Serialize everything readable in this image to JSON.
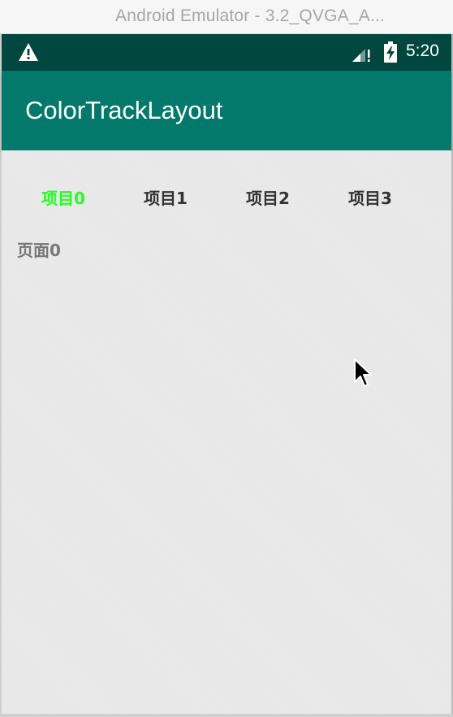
{
  "window": {
    "title": "Android Emulator - 3.2_QVGA_A..."
  },
  "status_bar": {
    "time": "5:20",
    "icons": [
      "warning-icon",
      "signal-icon",
      "battery-charging-icon"
    ]
  },
  "app_bar": {
    "title": "ColorTrackLayout"
  },
  "tabs": [
    {
      "label": "项目0",
      "active": true
    },
    {
      "label": "项目1",
      "active": false
    },
    {
      "label": "项目2",
      "active": false
    },
    {
      "label": "项目3",
      "active": false
    }
  ],
  "page": {
    "label": "页面0"
  },
  "colors": {
    "status_bar": "#02473f",
    "app_bar": "#03796b",
    "tab_active": "#22ff22",
    "tab_inactive": "#333333",
    "content_bg": "#eaeaea"
  }
}
